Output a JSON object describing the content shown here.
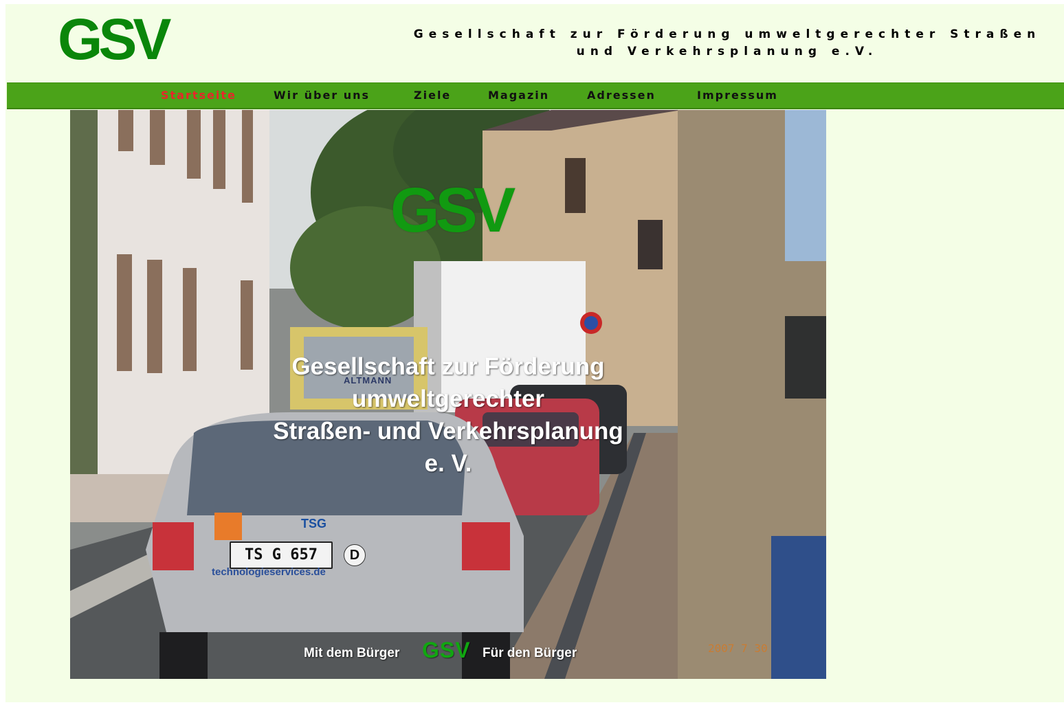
{
  "header": {
    "logo_text": "GSV",
    "org_line1": "Gesellschaft zur Förderung umweltgerechter Straßen",
    "org_line2": "und Verkehrsplanung e.V."
  },
  "nav": {
    "items": [
      {
        "label": "Startseite",
        "active": true
      },
      {
        "label": "Wir über uns",
        "active": false
      },
      {
        "label": "Ziele",
        "active": false
      },
      {
        "label": "Magazin",
        "active": false
      },
      {
        "label": "Adressen",
        "active": false
      },
      {
        "label": "Impressum",
        "active": false
      }
    ]
  },
  "hero": {
    "logo_text": "GSV",
    "title_lines": [
      "Gesellschaft zur Förderung",
      "umweltgerechter",
      "Straßen- und Verkehrsplanung",
      "e. V."
    ],
    "slogan_left": "Mit dem Bürger",
    "slogan_logo": "GSV",
    "slogan_right": "Für den Bürger",
    "date_stamp": "2007 7 30",
    "plate_text": "TS G 657",
    "plate_country": "D",
    "car_brand": "TSG",
    "car_url": "technologieservices.de",
    "truck_text": "ALTMANN"
  },
  "colors": {
    "page_bg": "#f4fee6",
    "brand_green": "#0a860a",
    "nav_bar": "#4ba319",
    "nav_active": "#e8262a",
    "nav_text": "#111111"
  }
}
